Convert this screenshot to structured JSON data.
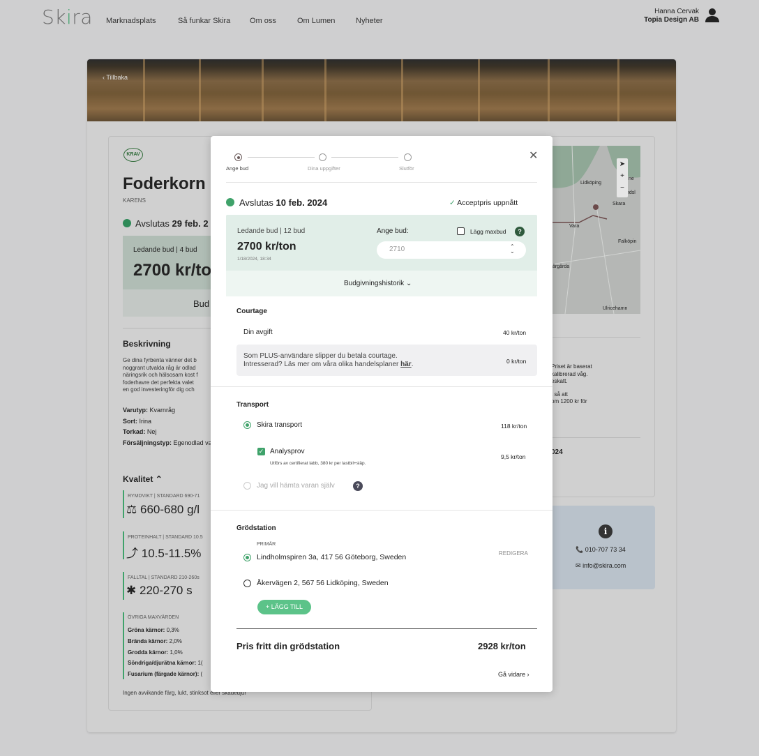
{
  "header": {
    "logo": {
      "pre": "Sk",
      "i": "i",
      "post": "ra"
    },
    "nav": [
      "Marknadsplats",
      "Så funkar Skira",
      "Om oss",
      "Om Lumen",
      "Nyheter"
    ],
    "user_name": "Hanna Cervak",
    "company": "Topia Design AB"
  },
  "hero": {
    "back": "‹ Tillbaka"
  },
  "background": {
    "certification": "KRAV",
    "title": "Foderkorn",
    "subtitle": "KARENS",
    "ends_label": "Avslutas",
    "ends_date": "29 feb. 2",
    "bid_label": "Ledande bud",
    "bid_count": "4 bud",
    "bid_price": "2700 kr/to",
    "bid_button": "Bud",
    "desc_heading": "Beskrivning",
    "desc_lines": [
      "Ge dina fyrbenta vänner det b",
      "noggrant utvalda råg är odlad",
      "näringsrik och hälsosam kost f",
      "foderhavre det perfekta valet",
      "en god investeringför dig och"
    ],
    "props": [
      [
        "Varutyp:",
        "Kvarnråg"
      ],
      [
        "Sort:",
        "Irina"
      ],
      [
        "Torkad:",
        "Nej"
      ],
      [
        "Försäljningstyp:",
        "Egenodlad va"
      ]
    ],
    "quality_heading": "Kvalitet",
    "quality": [
      {
        "label": "RYMDVIKT | STANDARD 690-71",
        "value": "660-680 g/l"
      },
      {
        "label": "PROTEINHALT | STANDARD 10.5",
        "value": "10.5-11.5%"
      },
      {
        "label": "FALLTAL | STANDARD 210-260s",
        "value": "220-270 s"
      }
    ],
    "other_label": "ÖVRIGA MAXVÄRDEN",
    "other": [
      [
        "Gröna kärnor:",
        "0,3%"
      ],
      [
        "Brända kärnor:",
        "2,0%"
      ],
      [
        "Grodda kärnor:",
        "1,0%"
      ],
      [
        "Söndriga/djurätna kärnor:",
        "1("
      ],
      [
        "Fusarium (färgade kärnor):",
        "("
      ]
    ],
    "footer_note": "Ingen avvikande färg, lukt, stinksot eller skadedjur",
    "right_lines": [
      "Priset är baserat",
      "kalibrerad våg.",
      "eskatt.",
      "t så att",
      "om 1200 kr för"
    ],
    "right_date": "024",
    "map_labels": [
      "Lidköping",
      "Skara",
      "Vara",
      "Falköpin",
      "årgårda",
      "Ulricehamn",
      "ne",
      "ndsl"
    ],
    "phone": "010-707 73 34",
    "email": "info@skira.com"
  },
  "modal": {
    "steps": [
      "Ange bud",
      "Dina uppgifter",
      "Slutför"
    ],
    "ends_label": "Avslutas",
    "ends_date": "10 feb. 2024",
    "accept_text": "Acceptpris uppnått",
    "leading_label": "Ledande bud",
    "bid_count": "12 bud",
    "leading_price": "2700 kr/ton",
    "leading_time": "1/18/2024, 18:34",
    "bid_input_label": "Ange bud:",
    "maxbid_label": "Lägg maxbud",
    "bid_placeholder": "2710",
    "history": "Budgivningshistorik",
    "courtage_heading": "Courtage",
    "fee_label": "Din avgift",
    "fee_value": "40 kr/ton",
    "plus_line1": "Som PLUS-användare slipper du betala courtage.",
    "plus_line2": "Intresserad? Läs mer om våra olika handelsplaner",
    "plus_link": "här",
    "plus_value": "0 kr/ton",
    "transport_heading": "Transport",
    "skira_transport": "Skira transport",
    "skira_transport_value": "118 kr/ton",
    "analys_label": "Analysprov",
    "analys_note": "Utförs av certifierat labb, 380 kr per lastbil+släp.",
    "analys_value": "9,5 kr/ton",
    "self_pickup": "Jag vill hämta varan själv",
    "station_heading": "Grödstation",
    "primary_label": "PRIMÄR",
    "station1": "Lindholmspiren 3a, 417 56 Göteborg, Sweden",
    "edit": "REDIGERA",
    "station2": "Åkervägen 2, 567 56 Lidköping, Sweden",
    "add": "+ LÄGG TILL",
    "total_label": "Pris fritt din grödstation",
    "total_value": "2928 kr/ton",
    "next": "Gå vidare"
  },
  "colors": {
    "accent": "#3fa26a",
    "dark_green": "#2f5a3d",
    "overlay": "#cfcfd0"
  }
}
